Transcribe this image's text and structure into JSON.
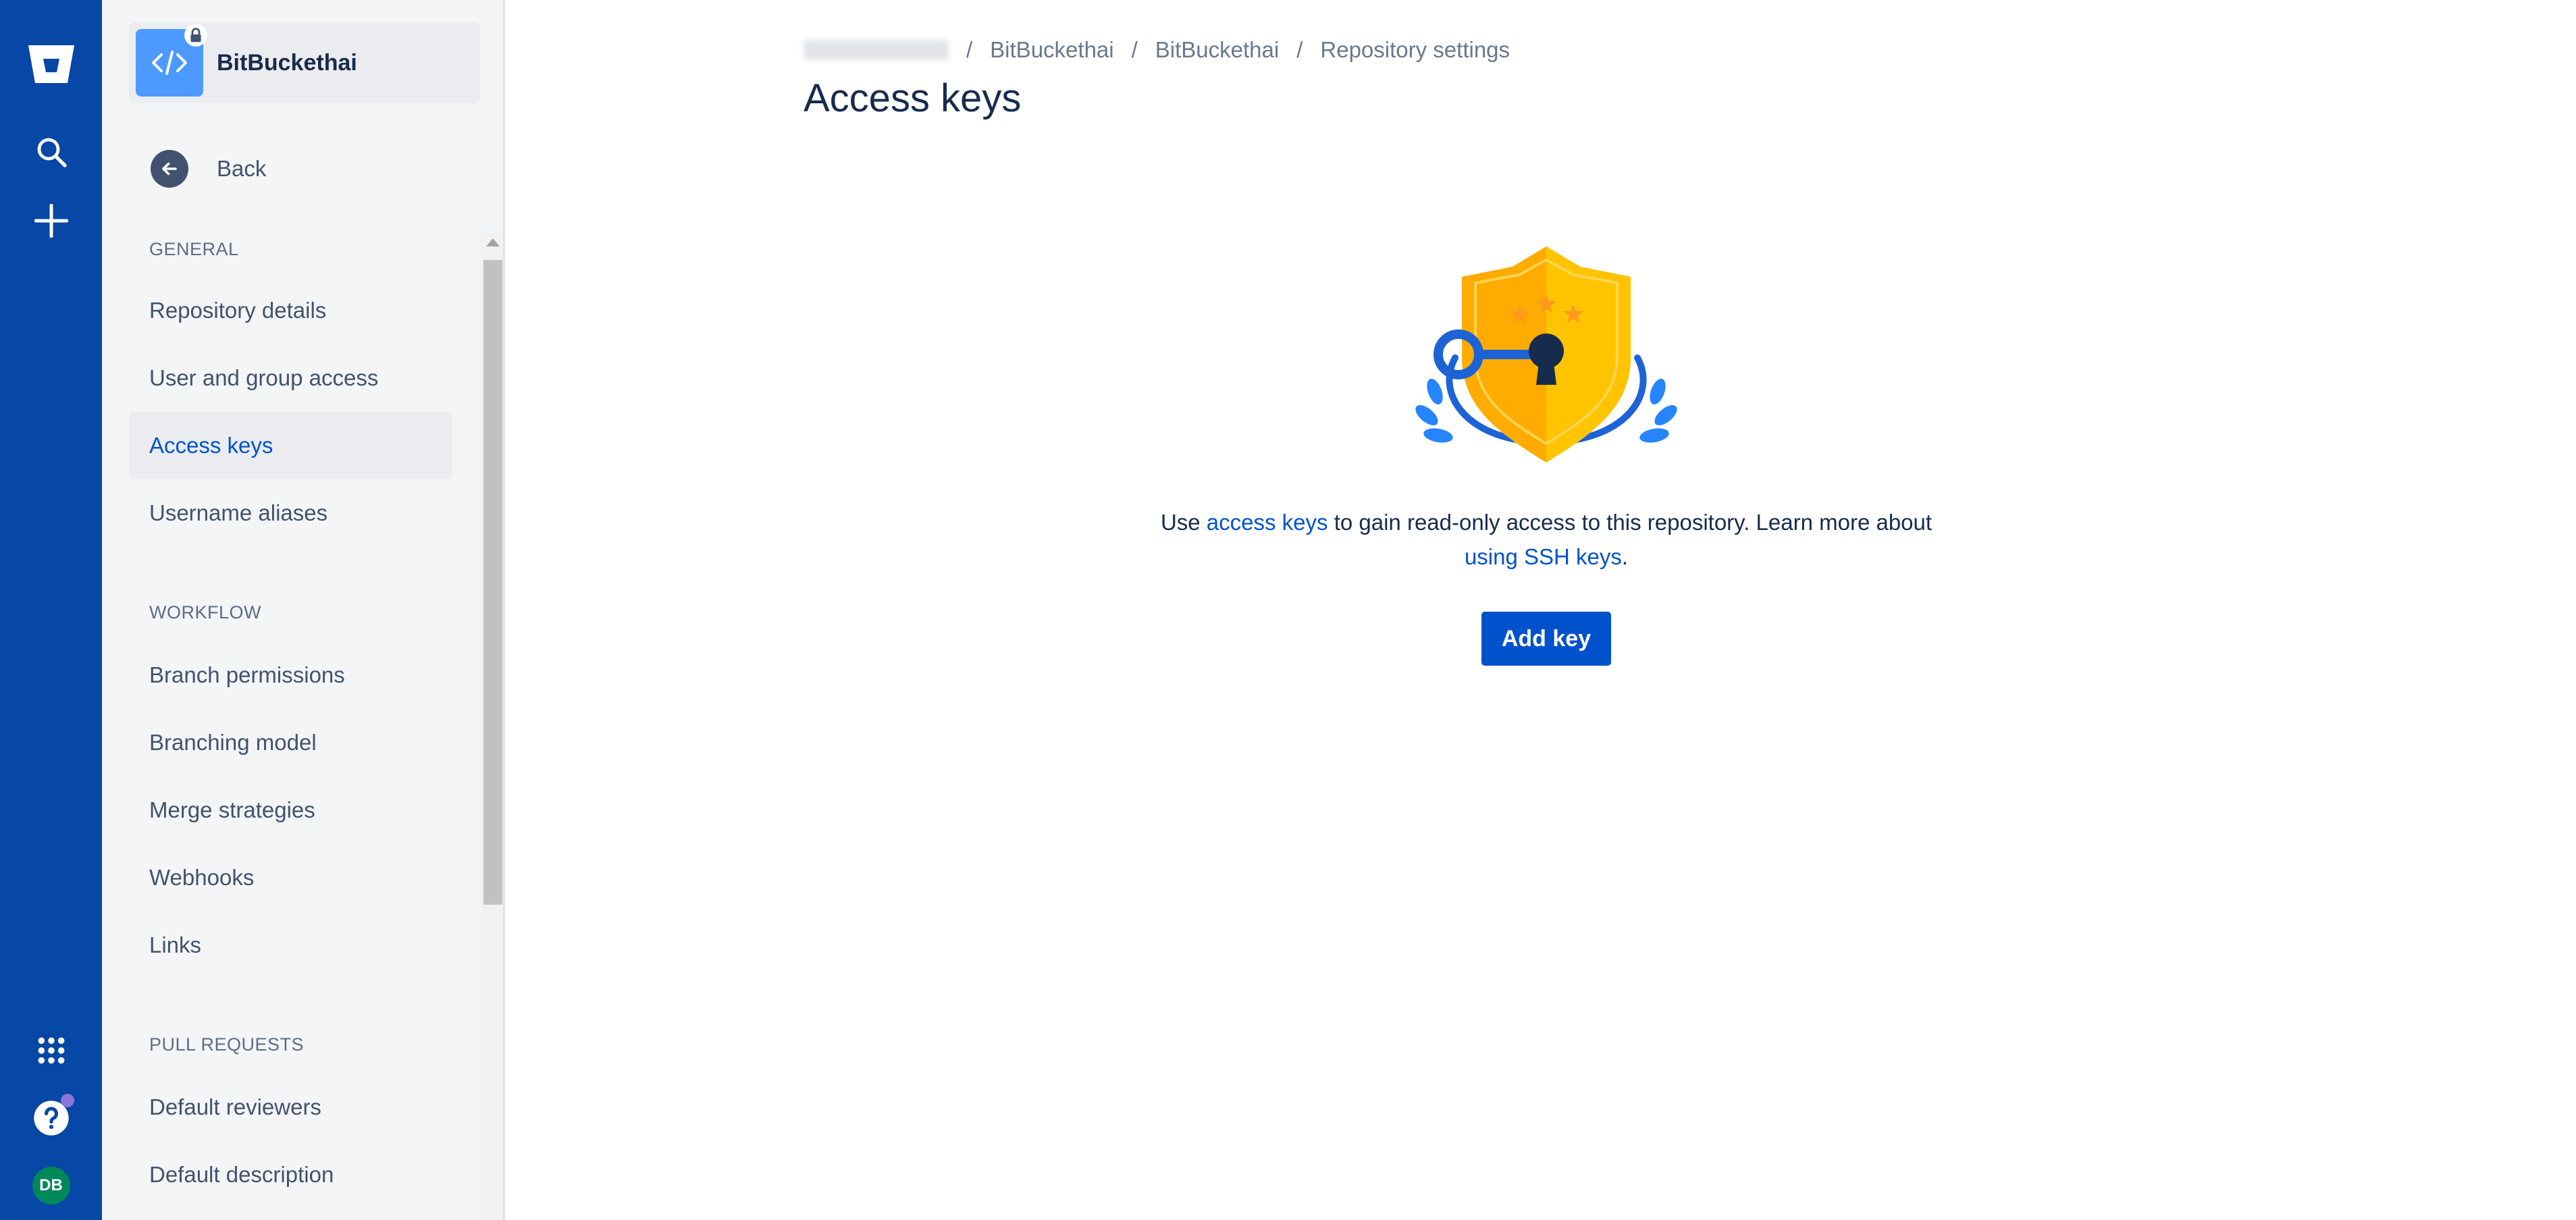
{
  "global_nav": {
    "icons": [
      "bitbucket-logo",
      "search-icon",
      "plus-icon",
      "apps-grid-icon",
      "help-icon"
    ],
    "avatar_initials": "DB",
    "colors": {
      "background": "#0747A6",
      "avatar": "#00875A",
      "notification": "#8777D9"
    }
  },
  "sidebar": {
    "repo_name": "BitBuckethai",
    "back_label": "Back",
    "sections": [
      {
        "title": "GENERAL",
        "items": [
          "Repository details",
          "User and group access",
          "Access keys",
          "Username aliases"
        ]
      },
      {
        "title": "WORKFLOW",
        "items": [
          "Branch permissions",
          "Branching model",
          "Merge strategies",
          "Webhooks",
          "Links"
        ]
      },
      {
        "title": "PULL REQUESTS",
        "items": [
          "Default reviewers",
          "Default description"
        ]
      }
    ],
    "active_item": "Access keys"
  },
  "main": {
    "breadcrumbs": [
      "BitBuckethai",
      "BitBuckethai",
      "Repository settings"
    ],
    "breadcrumb_separator": "/",
    "title": "Access keys",
    "description": {
      "p1": "Use ",
      "link1": "access keys",
      "p2": " to gain read-only access to this repository. Learn more about ",
      "link2": "using SSH keys",
      "p3": "."
    },
    "add_key_label": "Add key"
  },
  "colors": {
    "accent": "#0052CC",
    "text": "#172B4D",
    "muted": "#6B778C"
  }
}
